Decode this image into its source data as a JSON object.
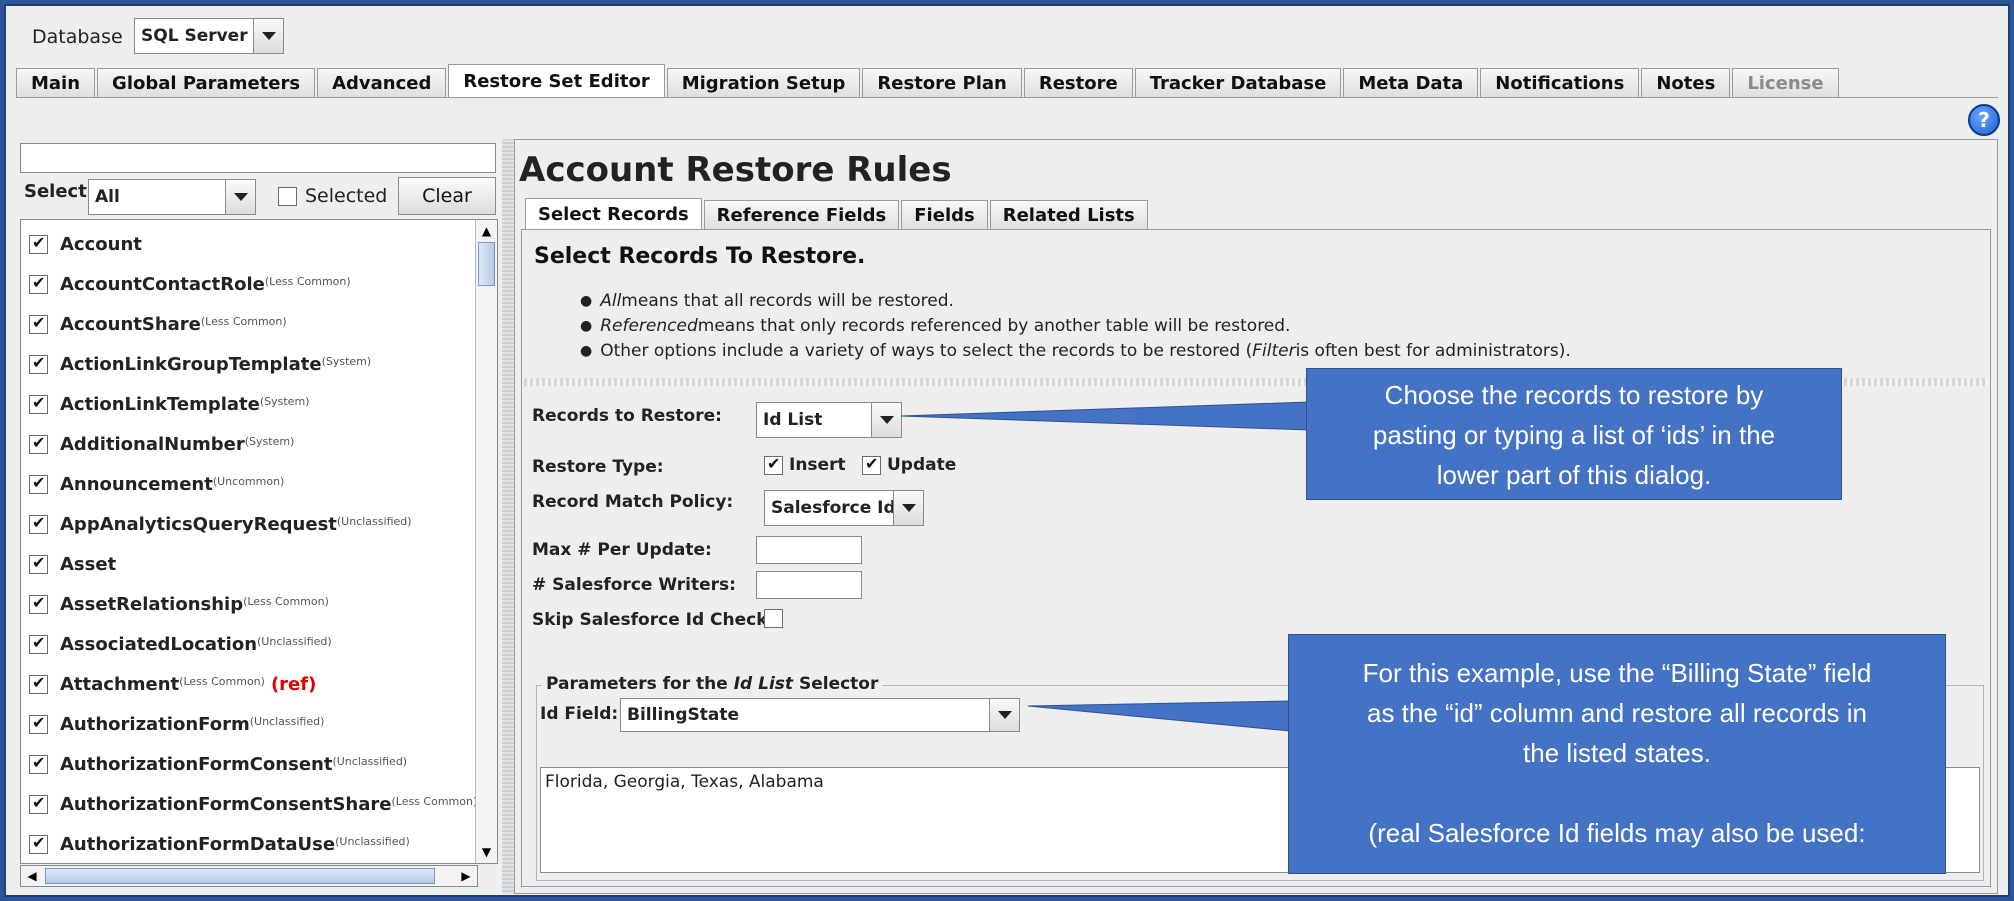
{
  "header": {
    "database_label": "Database",
    "database_value": "SQL Server"
  },
  "tabs": [
    {
      "label": "Main"
    },
    {
      "label": "Global Parameters"
    },
    {
      "label": "Advanced"
    },
    {
      "label": "Restore Set Editor"
    },
    {
      "label": "Migration Setup"
    },
    {
      "label": "Restore Plan"
    },
    {
      "label": "Restore"
    },
    {
      "label": "Tracker Database"
    },
    {
      "label": "Meta Data"
    },
    {
      "label": "Notifications"
    },
    {
      "label": "Notes"
    },
    {
      "label": "License"
    }
  ],
  "help_icon": "?",
  "left": {
    "search_value": "",
    "select_label": "Select:",
    "select_value": "All",
    "selected_label": "Selected",
    "clear_label": "Clear",
    "items": [
      {
        "name": "Account",
        "tag": ""
      },
      {
        "name": "AccountContactRole",
        "tag": "(Less Common)"
      },
      {
        "name": "AccountShare",
        "tag": "(Less Common)"
      },
      {
        "name": "ActionLinkGroupTemplate",
        "tag": "(System)"
      },
      {
        "name": "ActionLinkTemplate",
        "tag": "(System)"
      },
      {
        "name": "AdditionalNumber",
        "tag": "(System)"
      },
      {
        "name": "Announcement",
        "tag": "(Uncommon)"
      },
      {
        "name": "AppAnalyticsQueryRequest",
        "tag": "(Unclassified)"
      },
      {
        "name": "Asset",
        "tag": ""
      },
      {
        "name": "AssetRelationship",
        "tag": "(Less Common)"
      },
      {
        "name": "AssociatedLocation",
        "tag": "(Unclassified)"
      },
      {
        "name": "Attachment",
        "tag": "(Less Common)",
        "ref": "(ref)"
      },
      {
        "name": "AuthorizationForm",
        "tag": "(Unclassified)"
      },
      {
        "name": "AuthorizationFormConsent",
        "tag": "(Unclassified)"
      },
      {
        "name": "AuthorizationFormConsentShare",
        "tag": "(Less Common)"
      },
      {
        "name": "AuthorizationFormDataUse",
        "tag": "(Unclassified)"
      }
    ]
  },
  "right": {
    "title": "Account Restore Rules",
    "subtabs": [
      {
        "label": "Select Records"
      },
      {
        "label": "Reference Fields"
      },
      {
        "label": "Fields"
      },
      {
        "label": "Related Lists"
      }
    ],
    "section_title": "Select Records To Restore.",
    "bullets": [
      {
        "em": "All",
        "text": " means that all records will be restored."
      },
      {
        "em": "Referenced",
        "text": " means that only records referenced by another table will be restored."
      },
      {
        "pre": "Other options include a variety of ways to select the records to be restored (",
        "em": "Filter",
        "text": " is often best for administrators)."
      }
    ],
    "records_to_restore_label": "Records to Restore:",
    "records_to_restore_value": "Id List",
    "restore_type_label": "Restore Type:",
    "insert_label": "Insert",
    "update_label": "Update",
    "match_policy_label": "Record Match Policy:",
    "match_policy_value": "Salesforce Id",
    "max_per_update_label": "Max # Per Update:",
    "writers_label": "# Salesforce Writers:",
    "skip_check_label": "Skip Salesforce Id Check:",
    "params_title_pre": "Parameters for the ",
    "params_title_em": "Id List",
    "params_title_post": " Selector",
    "id_field_label": "Id Field:",
    "id_field_value": "BillingState",
    "id_list_text": "Florida, Georgia, Texas, Alabama"
  },
  "callouts": {
    "one": [
      "Choose the records to restore by",
      "pasting or typing a list of ‘ids’ in the",
      "lower part of this dialog."
    ],
    "two": [
      "For this example, use the “Billing State” field",
      "as the “id” column and restore all records in",
      "the listed states.",
      "",
      "(real Salesforce Id fields may also be used:"
    ]
  }
}
